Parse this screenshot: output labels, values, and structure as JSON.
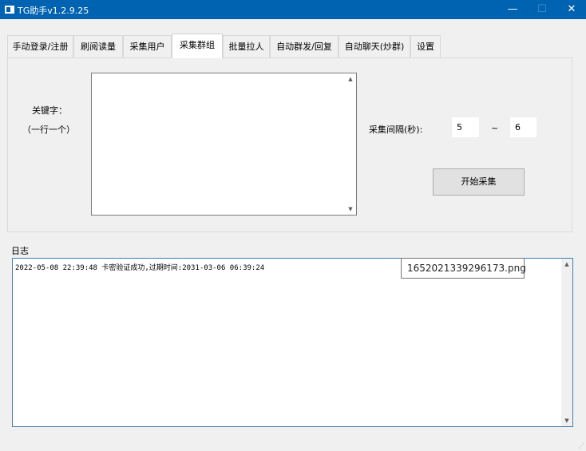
{
  "window": {
    "title": "TG助手v1.2.9.25",
    "controls": {
      "minimize": "—",
      "maximize": "☐",
      "close": "✕"
    }
  },
  "tabs": [
    {
      "label": "手动登录/注册"
    },
    {
      "label": "刷阅读量"
    },
    {
      "label": "采集用户"
    },
    {
      "label": "采集群组",
      "active": true
    },
    {
      "label": "批量拉人"
    },
    {
      "label": "自动群发/回复"
    },
    {
      "label": "自动聊天(炒群)"
    },
    {
      "label": "设置"
    }
  ],
  "collect_panel": {
    "keyword_label": "关键字：",
    "keyword_hint": "（一行一个）",
    "keywords_value": "",
    "interval_label": "采集间隔(秒):",
    "interval_min": "5",
    "interval_sep": "~",
    "interval_max": "6",
    "start_button": "开始采集"
  },
  "log": {
    "legend": "日志",
    "lines": [
      "2022-05-08 22:39:48 卡密验证成功,过期时间:2031-03-06 06:39:24"
    ]
  },
  "tooltip": {
    "text": "1652021339296173.png"
  }
}
